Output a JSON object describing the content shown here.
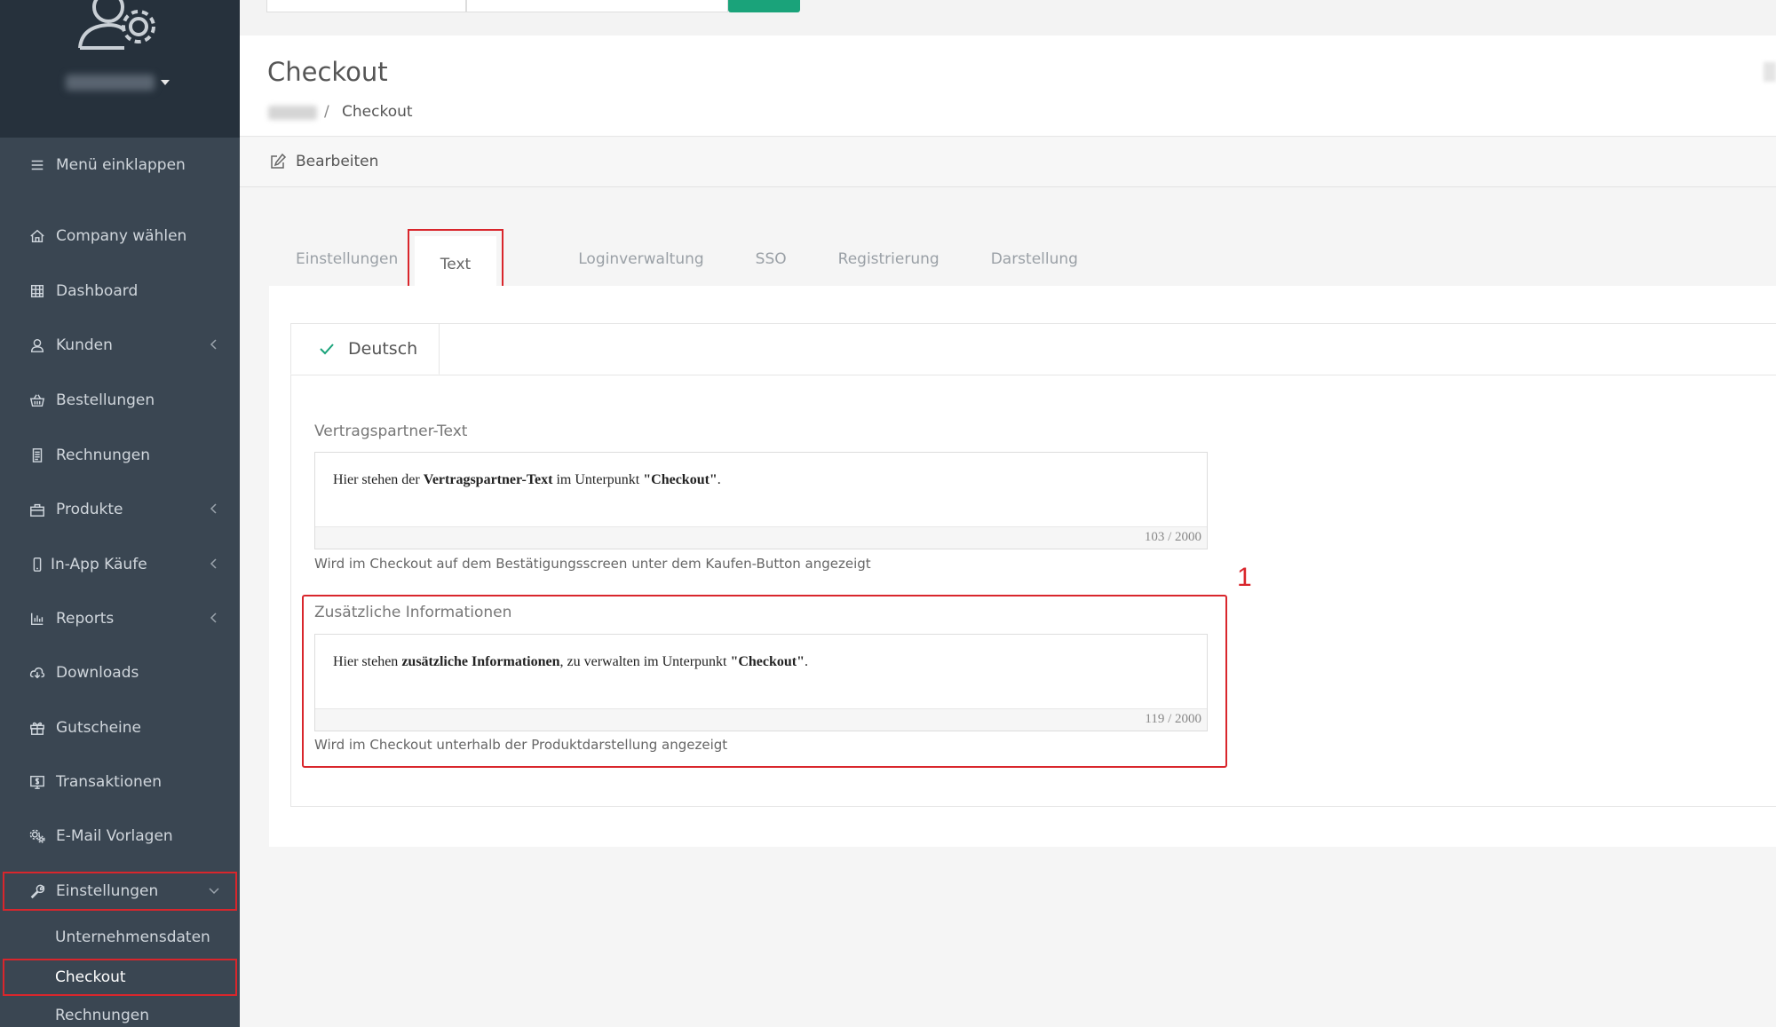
{
  "sidebar": {
    "collapse_label": "Menü einklappen",
    "items": [
      {
        "label": "Company wählen",
        "icon": "home-icon"
      },
      {
        "label": "Dashboard",
        "icon": "grid-icon"
      },
      {
        "label": "Kunden",
        "icon": "user-icon"
      },
      {
        "label": "Bestellungen",
        "icon": "basket-icon"
      },
      {
        "label": "Rechnungen",
        "icon": "receipt-icon"
      },
      {
        "label": "Produkte",
        "icon": "bag-icon"
      },
      {
        "label": "In-App Käufe",
        "icon": "phone-icon"
      },
      {
        "label": "Reports",
        "icon": "bar-chart-icon"
      },
      {
        "label": "Downloads",
        "icon": "cloud-download-icon"
      },
      {
        "label": "Gutscheine",
        "icon": "gift-icon"
      },
      {
        "label": "Transaktionen",
        "icon": "dollar-screen-icon"
      },
      {
        "label": "E-Mail Vorlagen",
        "icon": "gears-icon"
      },
      {
        "label": "Einstellungen",
        "icon": "wrench-icon"
      }
    ],
    "sub_items": {
      "company_data": "Unternehmensdaten",
      "checkout": "Checkout",
      "invoices": "Rechnungen"
    }
  },
  "header": {
    "title": "Checkout",
    "breadcrumb_separator": "/",
    "breadcrumb_current": "Checkout"
  },
  "toolbar": {
    "edit_label": "Bearbeiten"
  },
  "tabs": {
    "settings": "Einstellungen",
    "text": "Text",
    "login": "Loginverwaltung",
    "sso": "SSO",
    "registration": "Registrierung",
    "display": "Darstellung"
  },
  "language_tab": "Deutsch",
  "fields": {
    "contract_partner": {
      "label": "Vertragspartner-Text",
      "text_before": "Hier stehen der ",
      "text_bold": "Vertragspartner-Text",
      "text_middle": " im Unterpunkt ",
      "text_bold2": "\"Checkout\"",
      "text_after": ".",
      "counter": "103 / 2000",
      "hint": "Wird im Checkout auf dem Bestätigungsscreen unter dem Kaufen-Button angezeigt"
    },
    "additional_info": {
      "label": "Zusätzliche Informationen",
      "text_before": "Hier stehen ",
      "text_bold": "zusätzliche Informationen",
      "text_middle": ", zu verwalten im Unterpunkt ",
      "text_bold2": "\"Checkout\"",
      "text_after": ".",
      "counter": "119 / 2000",
      "hint": "Wird im Checkout unterhalb der Produktdarstellung angezeigt"
    }
  },
  "annotation_marker": "1",
  "colors": {
    "sidebar_bg": "#3a4652",
    "sidebar_top_bg": "#26313c",
    "highlight_red": "#d9262c",
    "accent_green": "#1aa37a"
  }
}
